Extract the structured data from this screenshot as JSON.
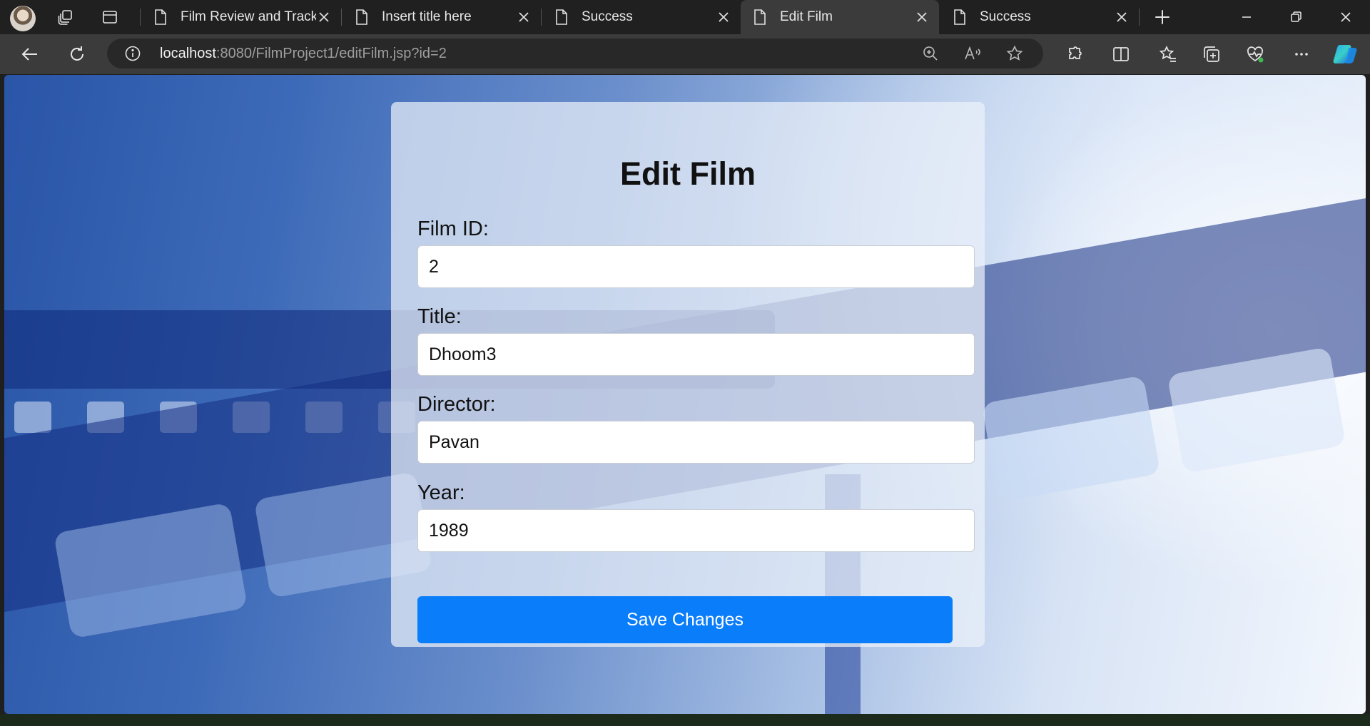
{
  "browser": {
    "tabs": [
      {
        "label": "Film Review and Trackir"
      },
      {
        "label": "Insert title here"
      },
      {
        "label": "Success"
      },
      {
        "label": "Edit Film",
        "active": true
      },
      {
        "label": "Success"
      }
    ],
    "address": {
      "host": "localhost",
      "rest": ":8080/FilmProject1/editFilm.jsp?id=2"
    }
  },
  "page": {
    "title": "Edit Film",
    "fields": [
      {
        "label": "Film ID:",
        "value": "2"
      },
      {
        "label": "Title:",
        "value": "Dhoom3"
      },
      {
        "label": "Director:",
        "value": "Pavan"
      },
      {
        "label": "Year:",
        "value": "1989"
      }
    ],
    "submit_label": "Save Changes"
  },
  "colors": {
    "accent": "#0a7dfb",
    "toolbar": "#3b3b3b",
    "tabstrip": "#202020"
  }
}
